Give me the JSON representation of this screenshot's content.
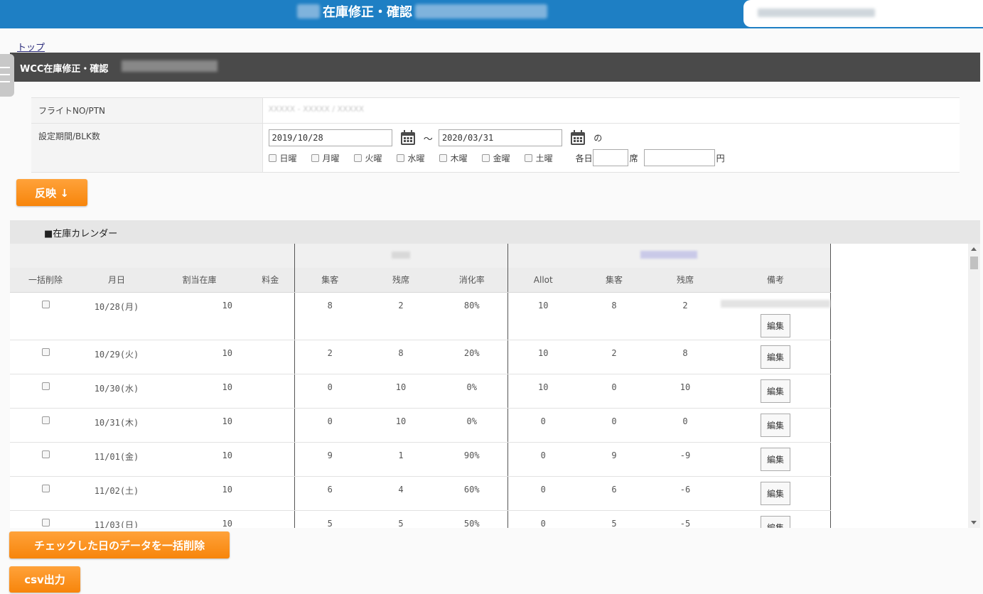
{
  "header": {
    "title": "在庫修正・確認"
  },
  "breadcrumb": {
    "top": "トップ"
  },
  "section": {
    "title": "WCC在庫修正・確認"
  },
  "form": {
    "flight_label": "フライトNO/PTN",
    "flight_value": "XXXXX - XXXXX / XXXXX",
    "period_label": "設定期間/BLK数",
    "start_date": "2019/10/28",
    "wave": "〜",
    "end_date": "2020/03/31",
    "no": "の",
    "weekdays": [
      "日曜",
      "月曜",
      "火曜",
      "水曜",
      "木曜",
      "金曜",
      "土曜"
    ],
    "each_day": "各日",
    "seats_unit": "席",
    "yen_unit": "円"
  },
  "reflect_button": "反映 ↓",
  "calendar": {
    "title": "■在庫カレンダー",
    "columns": [
      "一括削除",
      "月日",
      "割当在庫",
      "料金",
      "集客",
      "残席",
      "消化率",
      "Allot",
      "集客",
      "残席",
      "備考"
    ],
    "edit_label": "編集",
    "rows": [
      {
        "date": "10/28(月)",
        "alloc": "10",
        "fee": "",
        "wcc_book": "8",
        "wcc_rem": "2",
        "rate": "80%",
        "allot": "10",
        "book": "8",
        "rem": "2"
      },
      {
        "date": "10/29(火)",
        "alloc": "10",
        "fee": "",
        "wcc_book": "2",
        "wcc_rem": "8",
        "rate": "20%",
        "allot": "10",
        "book": "2",
        "rem": "8"
      },
      {
        "date": "10/30(水)",
        "alloc": "10",
        "fee": "",
        "wcc_book": "0",
        "wcc_rem": "10",
        "rate": "0%",
        "allot": "10",
        "book": "0",
        "rem": "10"
      },
      {
        "date": "10/31(木)",
        "alloc": "10",
        "fee": "",
        "wcc_book": "0",
        "wcc_rem": "10",
        "rate": "0%",
        "allot": "0",
        "book": "0",
        "rem": "0"
      },
      {
        "date": "11/01(金)",
        "alloc": "10",
        "fee": "",
        "wcc_book": "9",
        "wcc_rem": "1",
        "rate": "90%",
        "allot": "0",
        "book": "9",
        "rem": "-9"
      },
      {
        "date": "11/02(土)",
        "alloc": "10",
        "fee": "",
        "wcc_book": "6",
        "wcc_rem": "4",
        "rate": "60%",
        "allot": "0",
        "book": "6",
        "rem": "-6"
      },
      {
        "date": "11/03(日)",
        "alloc": "10",
        "fee": "",
        "wcc_book": "5",
        "wcc_rem": "5",
        "rate": "50%",
        "allot": "0",
        "book": "5",
        "rem": "-5"
      }
    ]
  },
  "bulk_delete_button": "チェックした日のデータを一括削除",
  "csv_button": "csv出力",
  "colors": {
    "header_blue": "#1e7fc4",
    "orange": "#f7850b",
    "dark_bar": "#4a4a4a"
  }
}
